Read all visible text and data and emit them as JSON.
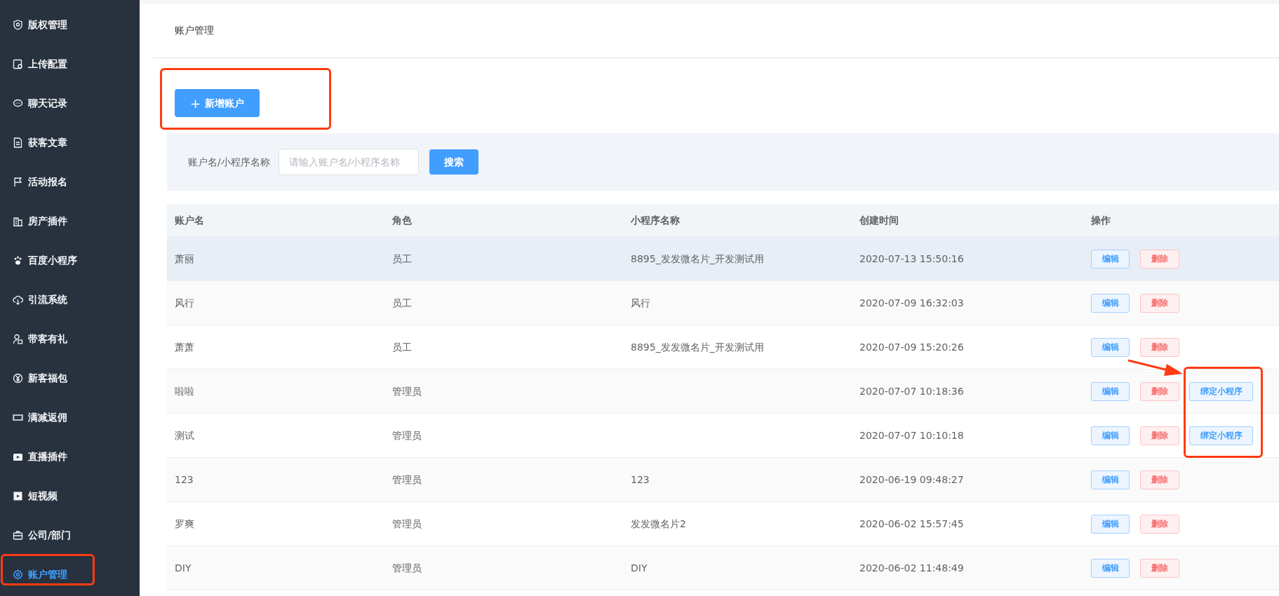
{
  "sidebar": {
    "items": [
      {
        "label": "版权管理",
        "selected": false
      },
      {
        "label": "上传配置",
        "selected": false
      },
      {
        "label": "聊天记录",
        "selected": false
      },
      {
        "label": "获客文章",
        "selected": false
      },
      {
        "label": "活动报名",
        "selected": false
      },
      {
        "label": "房产插件",
        "selected": false
      },
      {
        "label": "百度小程序",
        "selected": false
      },
      {
        "label": "引流系统",
        "selected": false
      },
      {
        "label": "带客有礼",
        "selected": false
      },
      {
        "label": "新客福包",
        "selected": false
      },
      {
        "label": "满减返佣",
        "selected": false
      },
      {
        "label": "直播插件",
        "selected": false
      },
      {
        "label": "短视频",
        "selected": false
      },
      {
        "label": "公司/部门",
        "selected": false
      },
      {
        "label": "账户管理",
        "selected": true
      }
    ]
  },
  "breadcrumb": "账户管理",
  "add_button": {
    "icon": "+",
    "label": "新增账户"
  },
  "search": {
    "label": "账户名/小程序名称",
    "placeholder": "请输入账户名/小程序名称",
    "button": "搜索"
  },
  "table": {
    "columns": [
      "账户名",
      "角色",
      "小程序名称",
      "创建时间",
      "操作"
    ],
    "rows": [
      {
        "account": "萧丽",
        "role": "员工",
        "miniprogram": "8895_发发微名片_开发测试用",
        "created": "2020-07-13 15:50:16",
        "hovered": true,
        "actions": [
          {
            "kind": "edit",
            "label": "编辑"
          },
          {
            "kind": "delete",
            "label": "删除"
          }
        ]
      },
      {
        "account": "风行",
        "role": "员工",
        "miniprogram": "风行",
        "created": "2020-07-09 16:32:03",
        "hovered": false,
        "actions": [
          {
            "kind": "edit",
            "label": "编辑"
          },
          {
            "kind": "delete",
            "label": "删除"
          }
        ]
      },
      {
        "account": "萧萧",
        "role": "员工",
        "miniprogram": "8895_发发微名片_开发测试用",
        "created": "2020-07-09 15:20:26",
        "hovered": false,
        "actions": [
          {
            "kind": "edit",
            "label": "编辑"
          },
          {
            "kind": "delete",
            "label": "删除"
          }
        ]
      },
      {
        "account": "啦啦",
        "role": "管理员",
        "created": "2020-07-07 10:18:36",
        "hovered": false,
        "actions": [
          {
            "kind": "edit",
            "label": "编辑"
          },
          {
            "kind": "delete",
            "label": "删除"
          },
          {
            "kind": "bind",
            "label": "绑定小程序"
          }
        ]
      },
      {
        "account": "测试",
        "role": "管理员",
        "created": "2020-07-07 10:10:18",
        "hovered": false,
        "actions": [
          {
            "kind": "edit",
            "label": "编辑"
          },
          {
            "kind": "delete",
            "label": "删除"
          },
          {
            "kind": "bind",
            "label": "绑定小程序"
          }
        ]
      },
      {
        "account": "123",
        "role": "管理员",
        "miniprogram": "123",
        "created": "2020-06-19 09:48:27",
        "hovered": false,
        "actions": [
          {
            "kind": "edit",
            "label": "编辑"
          },
          {
            "kind": "delete",
            "label": "删除"
          }
        ]
      },
      {
        "account": "罗爽",
        "role": "管理员",
        "miniprogram": "发发微名片2",
        "created": "2020-06-02 15:57:45",
        "hovered": false,
        "actions": [
          {
            "kind": "edit",
            "label": "编辑"
          },
          {
            "kind": "delete",
            "label": "删除"
          }
        ]
      },
      {
        "account": "DIY",
        "role": "管理员",
        "miniprogram": "DIY",
        "created": "2020-06-02 11:48:49",
        "hovered": false,
        "actions": [
          {
            "kind": "edit",
            "label": "编辑"
          },
          {
            "kind": "delete",
            "label": "删除"
          }
        ]
      }
    ]
  }
}
